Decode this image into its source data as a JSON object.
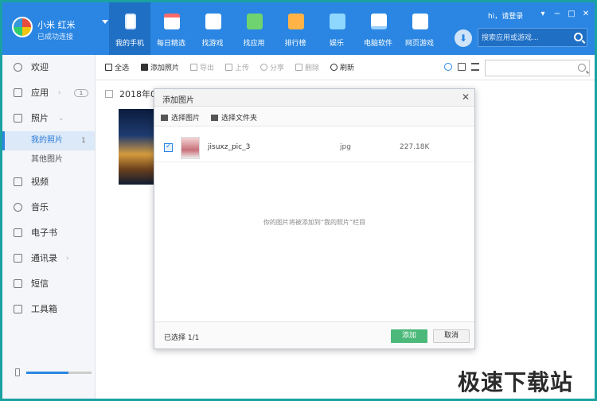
{
  "brand": {
    "name": "小米 红米",
    "status": "已成功连接"
  },
  "nav": [
    {
      "label": "我的手机",
      "icon": "phone-icon"
    },
    {
      "label": "每日精选",
      "icon": "calendar-star-icon"
    },
    {
      "label": "找游戏",
      "icon": "gamepad-icon"
    },
    {
      "label": "找应用",
      "icon": "app-bag-icon"
    },
    {
      "label": "排行榜",
      "icon": "ranking-medal-icon"
    },
    {
      "label": "娱乐",
      "icon": "entertainment-icon"
    },
    {
      "label": "电脑软件",
      "icon": "computer-icon"
    },
    {
      "label": "网页游戏",
      "icon": "web-game-icon"
    }
  ],
  "header": {
    "login": "hi，请登录",
    "search_placeholder": "搜索应用或游戏..."
  },
  "window_controls": {
    "menu": "▾",
    "minimize": "−",
    "maximize": "□",
    "close": "✕"
  },
  "sidebar": {
    "items": [
      {
        "label": "欢迎"
      },
      {
        "label": "应用",
        "arrow": "›",
        "badge": "1"
      },
      {
        "label": "照片",
        "arrow": "⌄"
      },
      {
        "label": "视频"
      },
      {
        "label": "音乐"
      },
      {
        "label": "电子书"
      },
      {
        "label": "通讯录",
        "arrow": "›"
      },
      {
        "label": "短信"
      },
      {
        "label": "工具箱"
      }
    ],
    "photo_sub": [
      {
        "label": "我的照片",
        "count": "1"
      },
      {
        "label": "其他图片"
      }
    ],
    "storage_used": 0.65
  },
  "toolbar": {
    "select_all": "全选",
    "add_photo": "添加照片",
    "export": "导出",
    "upload": "上传",
    "share": "分享",
    "delete": "删除",
    "refresh": "刷新"
  },
  "content": {
    "date_group": "2018年02"
  },
  "dialog": {
    "title": "添加图片",
    "close": "✕",
    "select_image": "选择图片",
    "select_folder": "选择文件夹",
    "file": {
      "name": "jisuxz_pic_3",
      "ext": "jpg",
      "size": "227.18K"
    },
    "hint": "你的图片将被添加到“我的照片”栏目",
    "selected": "已选择 1/1",
    "add": "添加",
    "cancel": "取消"
  },
  "watermark": "极速下载站"
}
